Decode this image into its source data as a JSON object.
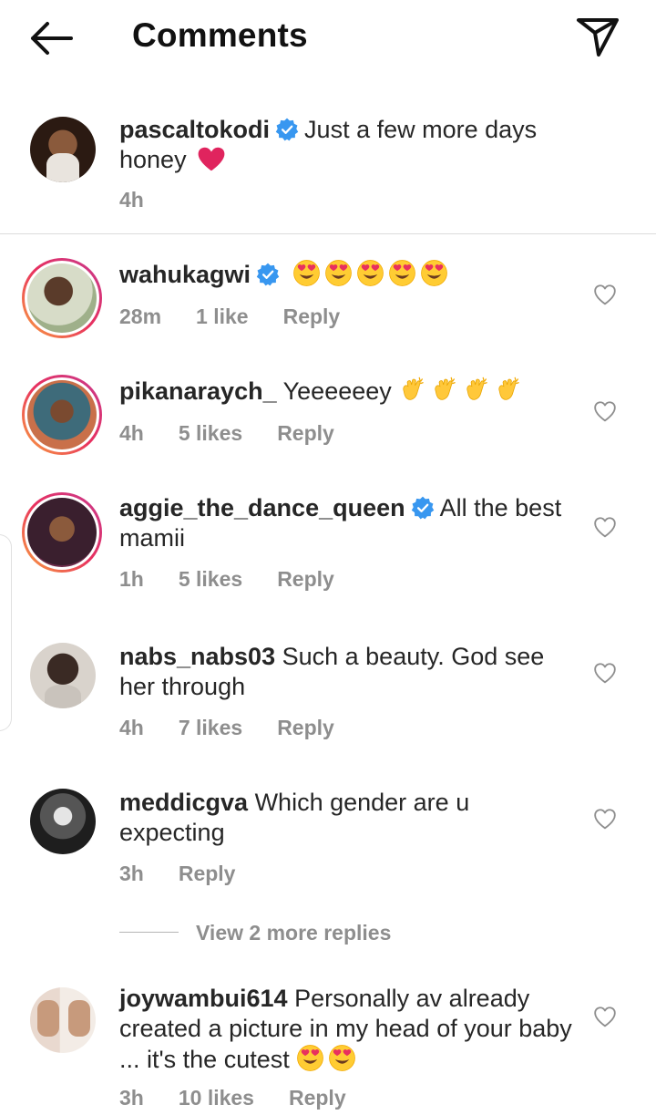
{
  "header": {
    "title": "Comments",
    "back_icon": "arrow-left-icon",
    "send_icon": "paper-plane-icon"
  },
  "caption": {
    "username": "pascaltokodi",
    "verified": true,
    "text": "Just a few more days honey",
    "emoji": "red-heart",
    "time": "4h"
  },
  "comments": [
    {
      "username": "wahukagwi",
      "verified": true,
      "text": "",
      "emoji": "heart-eyes x5",
      "time": "28m",
      "likes": "1 like",
      "reply": "Reply",
      "story_ring": true
    },
    {
      "username": "pikanaraych_",
      "verified": false,
      "text": "Yeeeeeey",
      "emoji": "clapping-hands x4",
      "time": "4h",
      "likes": "5 likes",
      "reply": "Reply",
      "story_ring": true
    },
    {
      "username": "aggie_the_dance_queen",
      "verified": true,
      "text": "All the best mamii",
      "time": "1h",
      "likes": "5 likes",
      "reply": "Reply",
      "story_ring": true
    },
    {
      "username": "nabs_nabs03",
      "verified": false,
      "text": "Such a beauty. God see her through",
      "time": "4h",
      "likes": "7 likes",
      "reply": "Reply",
      "story_ring": false
    },
    {
      "username": "meddicgva",
      "verified": false,
      "text": "Which gender are u expecting",
      "time": "3h",
      "likes": "",
      "reply": "Reply",
      "story_ring": false
    },
    {
      "username": "joywambui614",
      "verified": false,
      "text": "Personally av already created a picture in my head of your baby ... it's the cutest",
      "emoji": "heart-eyes x2",
      "time": "3h",
      "likes": "10 likes",
      "reply": "Reply",
      "story_ring": false
    }
  ],
  "view_more_replies": "View 2 more replies",
  "colors": {
    "verified_blue": "#3897f0",
    "heart_red": "#e0245e",
    "secondary_text": "#8e8e8e",
    "story_ring": "#e8305e"
  }
}
